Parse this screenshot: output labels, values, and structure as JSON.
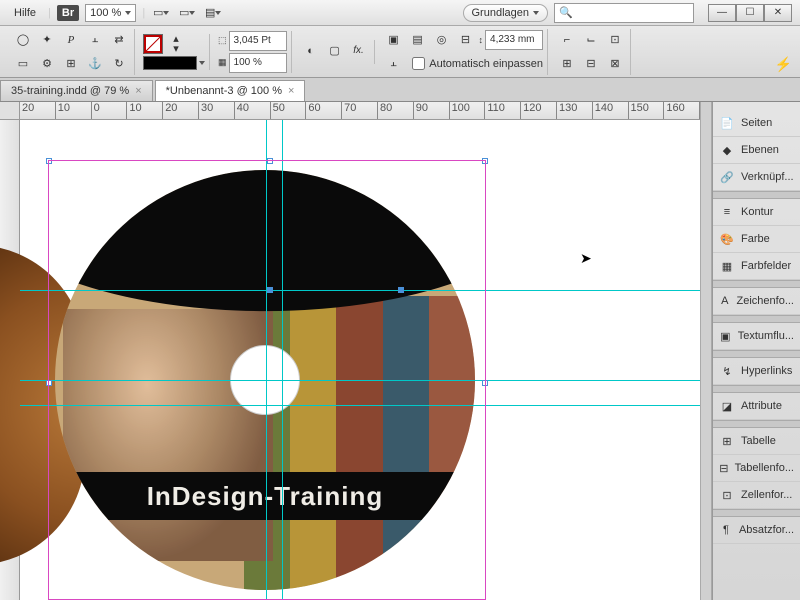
{
  "menubar": {
    "help": "Hilfe",
    "br": "Br",
    "zoom": "100 %",
    "workspace": "Grundlagen"
  },
  "toolbar": {
    "stroke_weight": "3,045 Pt",
    "opacity": "100 %",
    "gap": "4,233 mm",
    "auto_fit": "Automatisch einpassen"
  },
  "tabs": [
    {
      "label": "35-training.indd @ 79 %",
      "active": false
    },
    {
      "label": "*Unbenannt-3 @ 100 %",
      "active": true
    }
  ],
  "ruler": {
    "ticks": [
      "20",
      "10",
      "0",
      "10",
      "20",
      "30",
      "40",
      "50",
      "60",
      "70",
      "80",
      "90",
      "100",
      "110",
      "120",
      "130",
      "140",
      "150",
      "160"
    ]
  },
  "disc": {
    "title": "InDesign-Training"
  },
  "panels": [
    {
      "icon": "📄",
      "label": "Seiten"
    },
    {
      "icon": "◆",
      "label": "Ebenen"
    },
    {
      "icon": "🔗",
      "label": "Verknüpf..."
    },
    {
      "gap": true
    },
    {
      "icon": "≡",
      "label": "Kontur"
    },
    {
      "icon": "🎨",
      "label": "Farbe"
    },
    {
      "icon": "▦",
      "label": "Farbfelder"
    },
    {
      "gap": true
    },
    {
      "icon": "A",
      "label": "Zeichenfo..."
    },
    {
      "gap": true
    },
    {
      "icon": "▣",
      "label": "Textumflu..."
    },
    {
      "gap": true
    },
    {
      "icon": "↯",
      "label": "Hyperlinks"
    },
    {
      "gap": true
    },
    {
      "icon": "◪",
      "label": "Attribute"
    },
    {
      "gap": true
    },
    {
      "icon": "⊞",
      "label": "Tabelle"
    },
    {
      "icon": "⊟",
      "label": "Tabellenfo..."
    },
    {
      "icon": "⊡",
      "label": "Zellenfor..."
    },
    {
      "gap": true
    },
    {
      "icon": "¶",
      "label": "Absatzfor..."
    }
  ]
}
